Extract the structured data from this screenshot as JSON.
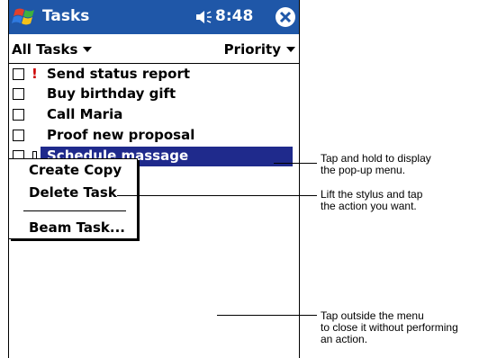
{
  "titlebar": {
    "app_title": "Tasks",
    "time": "8:48",
    "start_icon": "windows-flag-icon",
    "speaker_icon": "speaker-icon",
    "close_icon": "close-icon",
    "bg_color": "#1f57a8"
  },
  "filterbar": {
    "category": "All Tasks",
    "sort": "Priority"
  },
  "tasks": [
    {
      "label": "Send status report",
      "high_priority": true
    },
    {
      "label": "Buy birthday gift",
      "high_priority": false
    },
    {
      "label": "Call Maria",
      "high_priority": false
    },
    {
      "label": "Proof new proposal",
      "high_priority": false
    },
    {
      "label": "Schedule massage",
      "high_priority": false,
      "selected": true
    }
  ],
  "priority_mark": "!",
  "popup_menu": {
    "items": [
      "Create Copy",
      "Delete Task",
      "Beam Task..."
    ]
  },
  "callouts": [
    "Tap and hold to display\nthe pop-up menu.",
    "Lift the stylus and tap\nthe action you want.",
    "Tap outside the menu\nto close it without performing\nan action."
  ],
  "selection_color": "#1f2a8c"
}
